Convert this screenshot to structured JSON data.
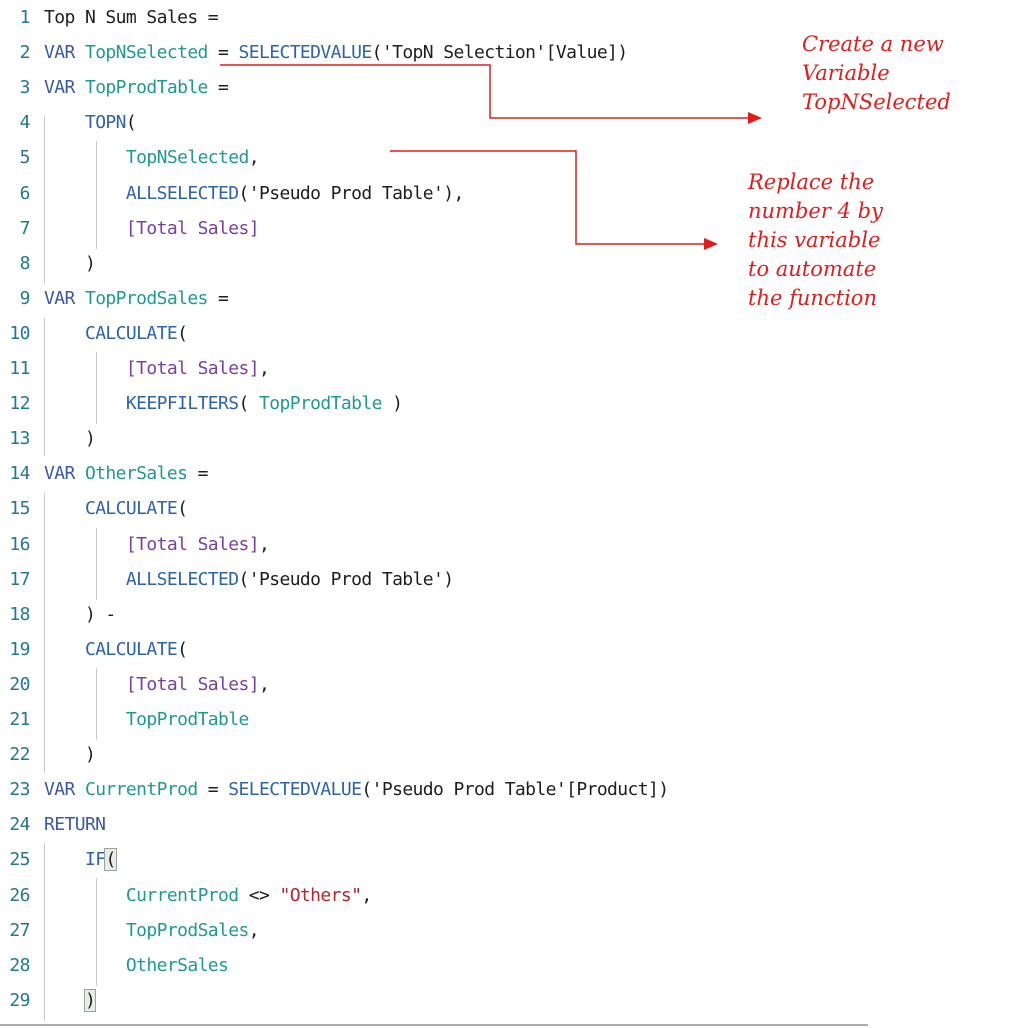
{
  "editor": {
    "language": "DAX",
    "lines": [
      {
        "n": "1",
        "tokens": [
          {
            "t": "Top N Sum Sales =",
            "c": "plain"
          }
        ]
      },
      {
        "n": "2",
        "tokens": [
          {
            "t": "VAR ",
            "c": "keyword"
          },
          {
            "t": "TopNSelected",
            "c": "variable"
          },
          {
            "t": " = ",
            "c": "plain"
          },
          {
            "t": "SELECTEDVALUE",
            "c": "function"
          },
          {
            "t": "('TopN Selection'[Value])",
            "c": "plain"
          }
        ]
      },
      {
        "n": "3",
        "tokens": [
          {
            "t": "VAR ",
            "c": "keyword"
          },
          {
            "t": "TopProdTable",
            "c": "variable"
          },
          {
            "t": " =",
            "c": "plain"
          }
        ]
      },
      {
        "n": "4",
        "tokens": [
          {
            "t": "    ",
            "c": "plain"
          },
          {
            "t": "TOPN",
            "c": "function"
          },
          {
            "t": "(",
            "c": "plain"
          }
        ]
      },
      {
        "n": "5",
        "tokens": [
          {
            "t": "        ",
            "c": "plain"
          },
          {
            "t": "TopNSelected",
            "c": "variable"
          },
          {
            "t": ",",
            "c": "plain"
          }
        ]
      },
      {
        "n": "6",
        "tokens": [
          {
            "t": "        ",
            "c": "plain"
          },
          {
            "t": "ALLSELECTED",
            "c": "function"
          },
          {
            "t": "('Pseudo Prod Table'),",
            "c": "plain"
          }
        ]
      },
      {
        "n": "7",
        "tokens": [
          {
            "t": "        ",
            "c": "plain"
          },
          {
            "t": "[Total Sales]",
            "c": "measure"
          }
        ]
      },
      {
        "n": "8",
        "tokens": [
          {
            "t": "    )",
            "c": "plain"
          }
        ]
      },
      {
        "n": "9",
        "tokens": [
          {
            "t": "VAR ",
            "c": "keyword"
          },
          {
            "t": "TopProdSales",
            "c": "variable"
          },
          {
            "t": " =",
            "c": "plain"
          }
        ]
      },
      {
        "n": "10",
        "tokens": [
          {
            "t": "    ",
            "c": "plain"
          },
          {
            "t": "CALCULATE",
            "c": "function"
          },
          {
            "t": "(",
            "c": "plain"
          }
        ]
      },
      {
        "n": "11",
        "tokens": [
          {
            "t": "        ",
            "c": "plain"
          },
          {
            "t": "[Total Sales]",
            "c": "measure"
          },
          {
            "t": ",",
            "c": "plain"
          }
        ]
      },
      {
        "n": "12",
        "tokens": [
          {
            "t": "        ",
            "c": "plain"
          },
          {
            "t": "KEEPFILTERS",
            "c": "function"
          },
          {
            "t": "( ",
            "c": "plain"
          },
          {
            "t": "TopProdTable",
            "c": "variable"
          },
          {
            "t": " )",
            "c": "plain"
          }
        ]
      },
      {
        "n": "13",
        "tokens": [
          {
            "t": "    )",
            "c": "plain"
          }
        ]
      },
      {
        "n": "14",
        "tokens": [
          {
            "t": "VAR ",
            "c": "keyword"
          },
          {
            "t": "OtherSales",
            "c": "variable"
          },
          {
            "t": " =",
            "c": "plain"
          }
        ]
      },
      {
        "n": "15",
        "tokens": [
          {
            "t": "    ",
            "c": "plain"
          },
          {
            "t": "CALCULATE",
            "c": "function"
          },
          {
            "t": "(",
            "c": "plain"
          }
        ]
      },
      {
        "n": "16",
        "tokens": [
          {
            "t": "        ",
            "c": "plain"
          },
          {
            "t": "[Total Sales]",
            "c": "measure"
          },
          {
            "t": ",",
            "c": "plain"
          }
        ]
      },
      {
        "n": "17",
        "tokens": [
          {
            "t": "        ",
            "c": "plain"
          },
          {
            "t": "ALLSELECTED",
            "c": "function"
          },
          {
            "t": "('Pseudo Prod Table')",
            "c": "plain"
          }
        ]
      },
      {
        "n": "18",
        "tokens": [
          {
            "t": "    ) -",
            "c": "plain"
          }
        ]
      },
      {
        "n": "19",
        "tokens": [
          {
            "t": "    ",
            "c": "plain"
          },
          {
            "t": "CALCULATE",
            "c": "function"
          },
          {
            "t": "(",
            "c": "plain"
          }
        ]
      },
      {
        "n": "20",
        "tokens": [
          {
            "t": "        ",
            "c": "plain"
          },
          {
            "t": "[Total Sales]",
            "c": "measure"
          },
          {
            "t": ",",
            "c": "plain"
          }
        ]
      },
      {
        "n": "21",
        "tokens": [
          {
            "t": "        ",
            "c": "plain"
          },
          {
            "t": "TopProdTable",
            "c": "variable"
          }
        ]
      },
      {
        "n": "22",
        "tokens": [
          {
            "t": "    )",
            "c": "plain"
          }
        ]
      },
      {
        "n": "23",
        "tokens": [
          {
            "t": "VAR ",
            "c": "keyword"
          },
          {
            "t": "CurrentProd",
            "c": "variable"
          },
          {
            "t": " = ",
            "c": "plain"
          },
          {
            "t": "SELECTEDVALUE",
            "c": "function"
          },
          {
            "t": "('Pseudo Prod Table'[Product])",
            "c": "plain"
          }
        ]
      },
      {
        "n": "24",
        "tokens": [
          {
            "t": "RETURN",
            "c": "keyword"
          }
        ]
      },
      {
        "n": "25",
        "tokens": [
          {
            "t": "    ",
            "c": "plain"
          },
          {
            "t": "IF",
            "c": "function"
          },
          {
            "t": "(",
            "c": "plain bracket-match"
          }
        ]
      },
      {
        "n": "26",
        "tokens": [
          {
            "t": "        ",
            "c": "plain"
          },
          {
            "t": "CurrentProd",
            "c": "variable"
          },
          {
            "t": " <> ",
            "c": "plain"
          },
          {
            "t": "\"Others\"",
            "c": "string"
          },
          {
            "t": ",",
            "c": "plain"
          }
        ]
      },
      {
        "n": "27",
        "tokens": [
          {
            "t": "        ",
            "c": "plain"
          },
          {
            "t": "TopProdSales",
            "c": "variable"
          },
          {
            "t": ",",
            "c": "plain"
          }
        ]
      },
      {
        "n": "28",
        "tokens": [
          {
            "t": "        ",
            "c": "plain"
          },
          {
            "t": "OtherSales",
            "c": "variable"
          }
        ]
      },
      {
        "n": "29",
        "tokens": [
          {
            "t": "    ",
            "c": "plain"
          },
          {
            "t": ")",
            "c": "plain bracket-match"
          }
        ]
      }
    ]
  },
  "annotations": {
    "note1": "Create a new\nVariable\nTopNSelected",
    "note2": "Replace the\nnumber 4 by\nthis variable\nto automate\nthe function",
    "color": "#e41b1b"
  }
}
